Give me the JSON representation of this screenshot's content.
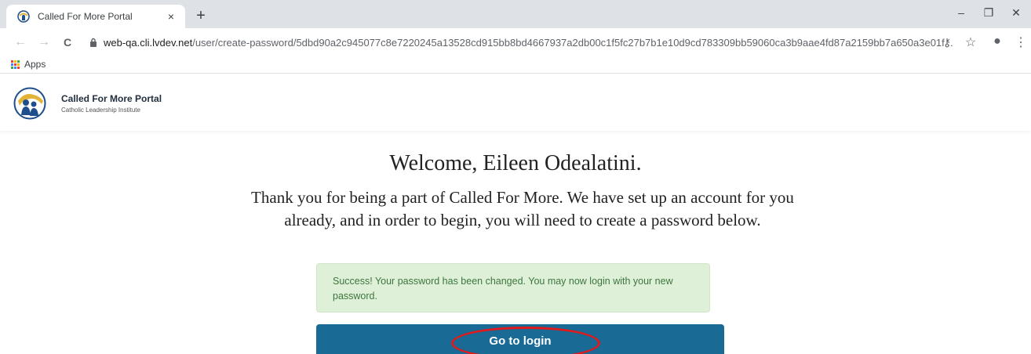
{
  "browser": {
    "tab_title": "Called For More Portal",
    "tab_close": "×",
    "new_tab": "+",
    "window_controls": {
      "minimize": "–",
      "restore": "❐",
      "close": "✕"
    },
    "nav": {
      "back": "←",
      "forward": "→",
      "reload": "C"
    },
    "url_host": "web-qa.cli.lvdev.net",
    "url_path": "/user/create-password/5dbd90a2c945077c8e7220245a13528cd915bb8bd4667937a2db00c1f5fc27b7b1e10d9cd783309bb59060ca3b9aae4fd87a2159bb7a650a3e01f...",
    "toolbar_icons": {
      "key": "⚷",
      "star": "☆",
      "account": "●",
      "menu": "⋮"
    },
    "bookmarks": {
      "apps_label": "Apps"
    },
    "apps_grid_colors": [
      "#ea4335",
      "#fbbc05",
      "#34a853",
      "#4285f4",
      "#ea4335",
      "#fbbc05",
      "#34a853",
      "#4285f4",
      "#ea4335"
    ]
  },
  "site": {
    "brand_title": "Called For More Portal",
    "brand_subtitle": "Catholic Leadership Institute",
    "logo_colors": {
      "ring": "#1f4e8c",
      "gold": "#e2b436",
      "figures": "#1f4e8c"
    }
  },
  "main": {
    "heading": "Welcome, Eileen Odealatini.",
    "intro": "Thank you for being a part of Called For More. We have set up an account for you already, and in order to begin, you will need to create a password below.",
    "alert_text": "Success! Your password has been changed. You may now login with your new password.",
    "login_button": "Go to login"
  },
  "colors": {
    "button_bg": "#1a6a96",
    "alert_bg": "#dff0d8",
    "alert_text": "#3c763d",
    "annotation": "#e0191b"
  }
}
